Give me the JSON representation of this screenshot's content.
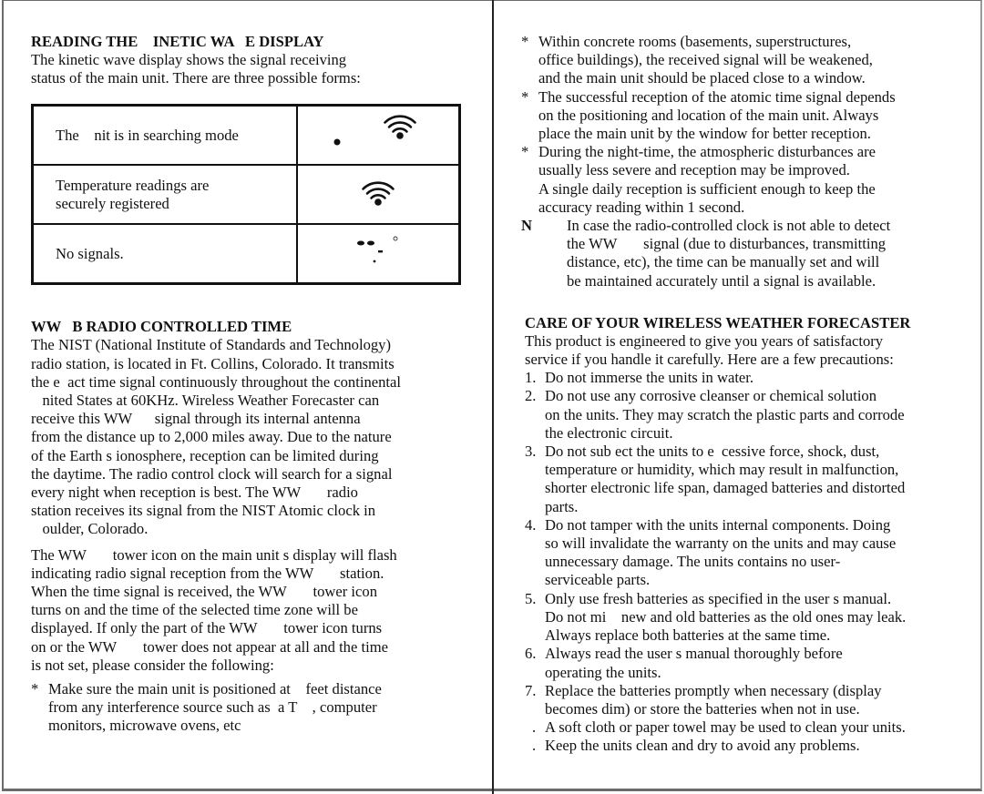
{
  "left_column": {
    "kinetic_heading": "READING THE    INETIC WA   E DISPLAY",
    "kinetic_intro": [
      "The kinetic wave display shows the signal receiving",
      "status of the main unit. There are three possible forms:"
    ],
    "status_table": [
      {
        "text": [
          "The    nit is in searching mode"
        ],
        "icon": "signal-searching-icon"
      },
      {
        "text": [
          "Temperature readings are",
          "securely registered"
        ],
        "icon": "signal-registered-icon"
      },
      {
        "text": [
          "No signals."
        ],
        "icon": "no-signal-icon"
      }
    ],
    "wwvb_heading": "WW   B RADIO CONTROLLED TIME",
    "wwvb_paragraph_1": [
      "The NIST (National Institute of Standards and Technology)",
      "radio station, is located in Ft. Collins, Colorado. It transmits",
      "the e  act time signal continuously throughout the continental",
      "   nited States at 60KHz. Wireless Weather Forecaster can",
      "receive this WW      signal through its internal antenna",
      "from the distance up to 2,000 miles away. Due to the nature",
      "of the Earth s ionosphere, reception can be limited during",
      "the daytime. The radio control clock will search for a signal",
      "every night when reception is best. The WW       radio",
      "station receives its signal from the NIST Atomic clock in",
      "   oulder, Colorado."
    ],
    "wwvb_paragraph_2": [
      "The WW       tower icon on the main unit s display will flash",
      "indicating radio signal reception from the WW       station.",
      "When the time signal is received, the WW       tower icon",
      "turns on and the time of the selected time zone will be",
      "displayed. If only the part of the WW       tower icon turns",
      "on or the WW       tower does not appear at all and the time",
      "is not set, please consider the following:"
    ],
    "bullets": [
      {
        "mark": "*",
        "lines": [
          "Make sure the main unit is positioned at    feet distance",
          "from any interference source such as  a T    , computer",
          "monitors, microwave ovens, etc"
        ]
      }
    ]
  },
  "right_column": {
    "bullets": [
      {
        "mark": "*",
        "lines": [
          "Within concrete rooms (basements, superstructures,",
          "office buildings), the received signal will be weakened,",
          "and the main unit should be placed close to a window."
        ]
      },
      {
        "mark": "*",
        "lines": [
          "The successful reception of the atomic time signal depends",
          "on the positioning and location of the main unit. Always",
          "place the main unit by the window for better reception."
        ]
      },
      {
        "mark": "*",
        "lines": [
          "During the night-time, the atmospheric disturbances are",
          "usually less severe and reception may be improved.",
          "A single daily reception is sufficient enough to keep the",
          "accuracy reading within 1 second."
        ]
      }
    ],
    "note": {
      "mark": "N",
      "lines": [
        "In case the radio-controlled clock is not able to detect",
        "the WW       signal (due to disturbances, transmitting",
        "distance, etc), the time can be manually set and will",
        "be maintained accurately until a signal is available."
      ]
    },
    "care_heading": "CARE OF YOUR WIRELESS WEATHER FORECASTER",
    "care_intro": [
      "This product is engineered to give you years of satisfactory",
      "service if you handle it carefully. Here are a few precautions:"
    ],
    "care_items": [
      {
        "mark": "1.",
        "lines": [
          "Do not immerse the units in water."
        ]
      },
      {
        "mark": "2.",
        "lines": [
          "Do not use any corrosive cleanser or chemical solution",
          "on the units. They may scratch the plastic parts and corrode",
          "the electronic circuit."
        ]
      },
      {
        "mark": "3.",
        "lines": [
          "Do not sub ect the units to e  cessive force, shock, dust,",
          "temperature or humidity, which may result in malfunction,",
          "shorter electronic life span, damaged batteries and distorted",
          "parts."
        ]
      },
      {
        "mark": "4.",
        "lines": [
          "Do not tamper with the units internal components. Doing",
          "so will invalidate the warranty on the units and may cause",
          "unnecessary damage. The units contains no user-",
          "serviceable parts."
        ]
      },
      {
        "mark": "5.",
        "lines": [
          "Only use fresh batteries as specified in the user s manual.",
          "Do not mi    new and old batteries as the old ones may leak.",
          "Always replace both batteries at the same time."
        ]
      },
      {
        "mark": "6.",
        "lines": [
          "Always read the user s manual thoroughly before",
          "operating the units."
        ]
      },
      {
        "mark": "7.",
        "lines": [
          "Replace the batteries promptly when necessary (display",
          "becomes dim) or store the batteries when not in use."
        ]
      },
      {
        "mark": ".",
        "lines": [
          "A soft cloth or paper towel may be used to clean your units."
        ]
      },
      {
        "mark": ".",
        "lines": [
          "Keep the units clean and dry to avoid any problems."
        ]
      }
    ]
  }
}
